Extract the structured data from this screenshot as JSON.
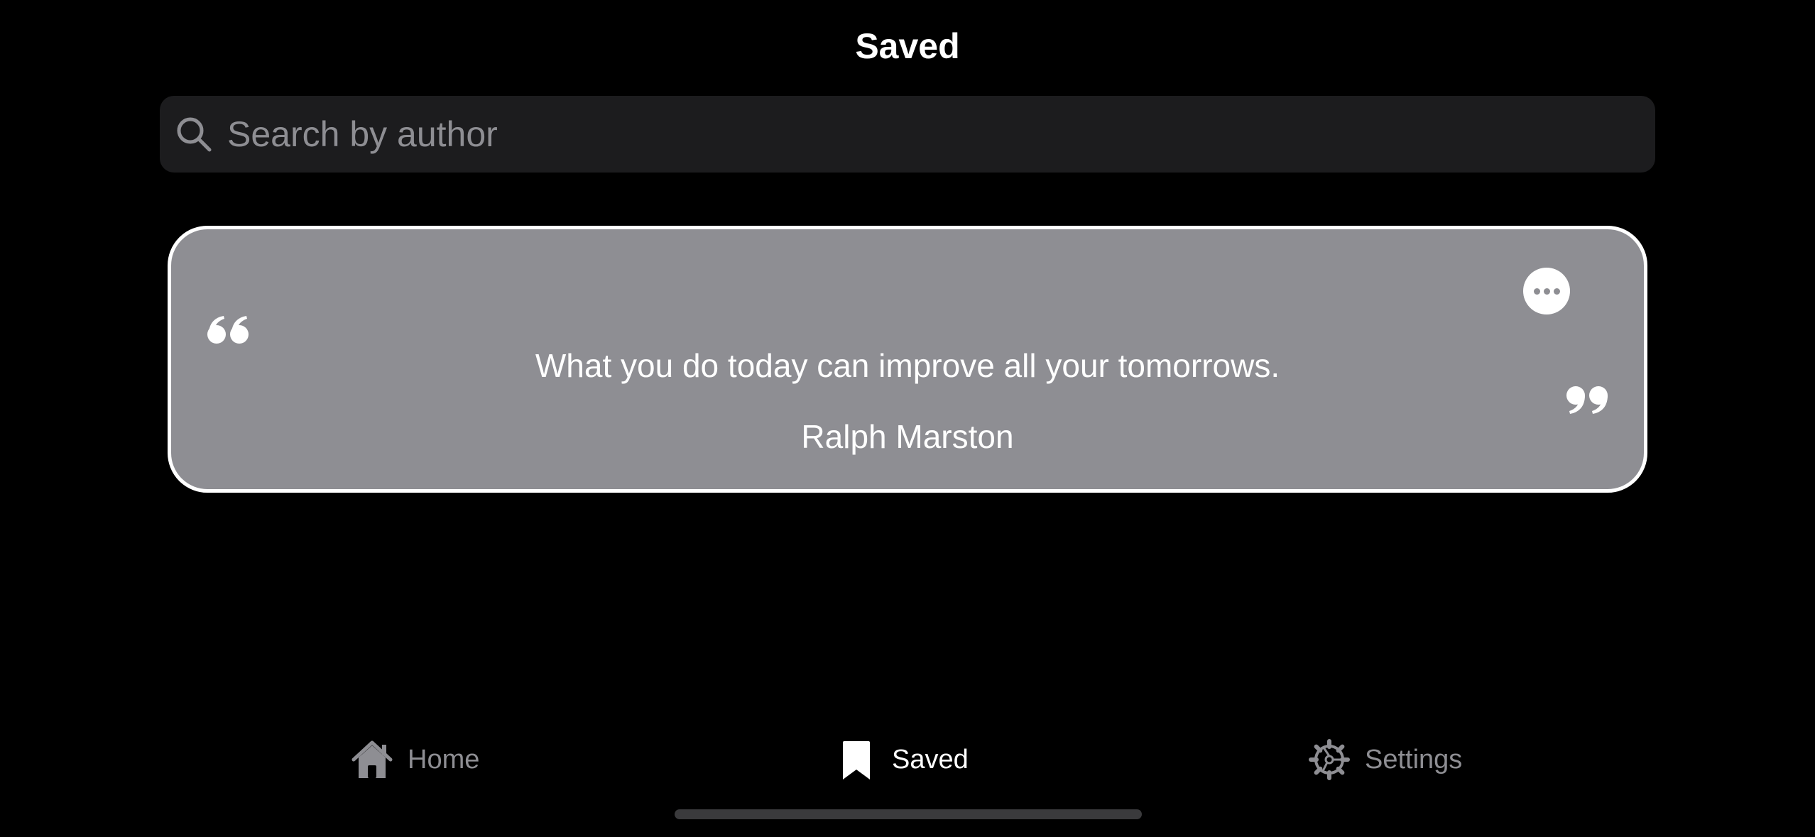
{
  "header": {
    "title": "Saved"
  },
  "search": {
    "placeholder": "Search by author",
    "value": "",
    "icon": "magnifying-glass-icon"
  },
  "saved_quotes": [
    {
      "text": "What you do today can improve all your tomorrows.",
      "author": "Ralph Marston",
      "more_icon": "ellipsis-circle-icon"
    }
  ],
  "tab_bar": {
    "active": "Saved",
    "items": [
      {
        "label": "Home",
        "icon": "house-icon"
      },
      {
        "label": "Saved",
        "icon": "bookmark-icon"
      },
      {
        "label": "Settings",
        "icon": "gear-icon"
      }
    ]
  },
  "colors": {
    "background": "#000000",
    "search_field": "#1c1c1e",
    "card": "#8e8e93",
    "card_border": "#ffffff",
    "inactive_tab": "#8e8e93",
    "active_tab": "#ffffff"
  }
}
